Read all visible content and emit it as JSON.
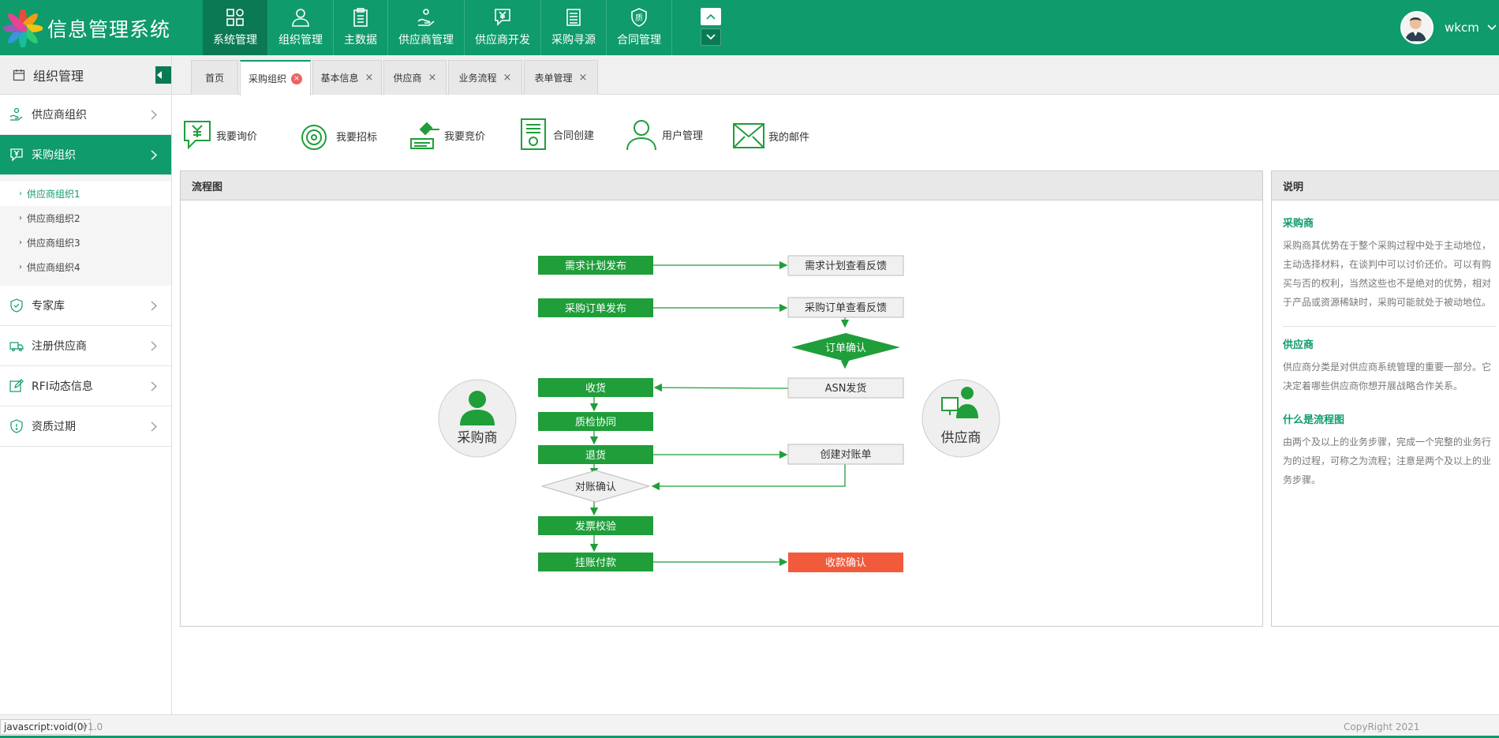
{
  "app": {
    "title": "信息管理系统"
  },
  "nav": {
    "items": [
      {
        "label": "系统管理",
        "icon": "grid-icon"
      },
      {
        "label": "组织管理",
        "icon": "user-icon"
      },
      {
        "label": "主数据",
        "icon": "clipboard-icon"
      },
      {
        "label": "供应商管理",
        "icon": "supplier-icon"
      },
      {
        "label": "供应商开发",
        "icon": "yen-chat-icon"
      },
      {
        "label": "采购寻源",
        "icon": "list-icon"
      },
      {
        "label": "合同管理",
        "icon": "quality-icon"
      }
    ],
    "active": 0
  },
  "user": {
    "name": "wkcm"
  },
  "sidebar": {
    "title": "组织管理",
    "items": [
      {
        "label": "供应商组织",
        "icon": "supplier-hand-icon"
      },
      {
        "label": "采购组织",
        "icon": "yen-chat-icon"
      },
      {
        "label": "专家库",
        "icon": "shield-icon"
      },
      {
        "label": "注册供应商",
        "icon": "truck-icon"
      },
      {
        "label": "RFI动态信息",
        "icon": "edit-icon"
      },
      {
        "label": "资质过期",
        "icon": "badge-icon"
      }
    ],
    "submenu": [
      "供应商组织1",
      "供应商组织2",
      "供应商组织3",
      "供应商组织4"
    ]
  },
  "tabs": [
    "首页",
    "采购组织",
    "基本信息",
    "供应商",
    "业务流程",
    "表单管理"
  ],
  "quick_actions": [
    "我要询价",
    "我要招标",
    "我要竞价",
    "合同创建",
    "用户管理",
    "我的邮件"
  ],
  "flow": {
    "title": "流程图",
    "buyer": "采购商",
    "supplier": "供应商",
    "left_nodes": [
      "需求计划发布",
      "采购订单发布",
      "收货",
      "质检协同",
      "退货",
      "对账确认",
      "发票校验",
      "挂账付款"
    ],
    "right_nodes": [
      "需求计划查看反馈",
      "采购订单查看反馈",
      "订单确认",
      "ASN发货",
      "创建对账单",
      "收款确认"
    ]
  },
  "description": {
    "title": "说明",
    "sections": [
      {
        "heading": "采购商",
        "text": "采购商其优势在于整个采购过程中处于主动地位，主动选择材料，在谈判中可以讨价还价。可以有购买与否的权利，当然这些也不是绝对的优势，相对于产品或资源稀缺时，采购可能就处于被动地位。"
      },
      {
        "heading": "供应商",
        "text": "供应商分类是对供应商系统管理的重要一部分。它决定着哪些供应商你想开展战略合作关系。"
      },
      {
        "heading": "什么是流程图",
        "text": "由两个及以上的业务步骤，完成一个完整的业务行为的过程，可称之为流程；注意是两个及以上的业务步骤。"
      }
    ]
  },
  "footer": {
    "status": "javascript:void(0)",
    "version": "v1.0",
    "copyright": "CopyRight 2021"
  },
  "colors": {
    "primary": "#0f9b6c",
    "dark": "#0b7a54",
    "node": "#1f9e3a",
    "alert": "#f25a3c"
  }
}
